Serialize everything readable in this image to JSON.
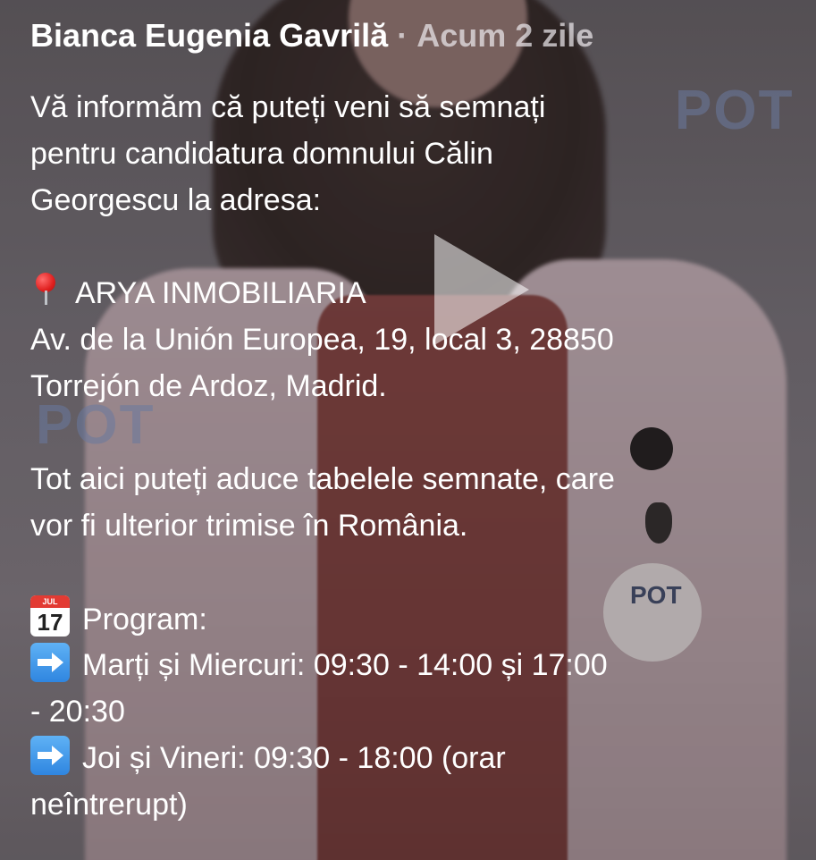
{
  "post": {
    "author": "Bianca Eugenia Gavrilă",
    "separator": "·",
    "time": "Acum 2 zile",
    "lines": {
      "l1": "Vă informăm că puteți veni să semnați",
      "l2": "pentru candidatura domnului  Călin",
      "l3": "Georgescu la adresa:",
      "l4": "ARYA INMOBILIARIA",
      "l5": "Av. de la Unión Europea, 19, local 3, 28850",
      "l6": "Torrejón de Ardoz, Madrid.",
      "l7": "Tot aici puteți aduce tabelele semnate, care",
      "l8": "vor fi ulterior trimise în România.",
      "l9": "Program:",
      "l10": "Marți și Miercuri: 09:30 - 14:00 și 17:00",
      "l11": "- 20:30",
      "l12": "Joi și Vineri: 09:30 - 18:00 (orar",
      "l13": "neîntrerupt)"
    },
    "calendar_emoji": {
      "month": "JUL",
      "day": "17"
    },
    "icons": {
      "pin": "round-pushpin-icon",
      "calendar": "calendar-icon",
      "arrow": "right-arrow-icon",
      "play": "play-icon"
    },
    "background_logos": {
      "logo1": "POT",
      "logo2": "POT",
      "badge": "POT"
    }
  }
}
